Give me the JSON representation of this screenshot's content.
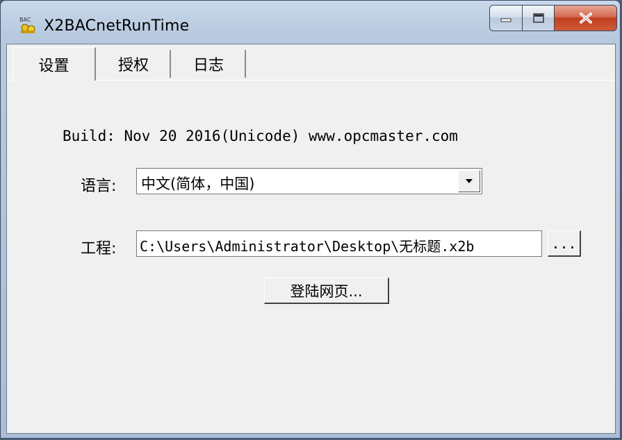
{
  "window": {
    "title": "X2BACnetRunTime",
    "app_icon": "bac-icon",
    "app_icon_text": "BAC"
  },
  "caption_buttons": {
    "minimize": "minimize-icon",
    "maximize": "maximize-icon",
    "close": "close-icon"
  },
  "tabs": [
    {
      "label": "设置",
      "active": true
    },
    {
      "label": "授权",
      "active": false
    },
    {
      "label": "日志",
      "active": false
    }
  ],
  "settings": {
    "build_info": "Build: Nov 20 2016(Unicode) www.opcmaster.com",
    "language_label": "语言:",
    "language_value": "中文(简体，中国)",
    "project_label": "工程:",
    "project_path": "C:\\Users\\Administrator\\Desktop\\无标题.x2b",
    "browse_label": "...",
    "login_label": "登陆网页..."
  }
}
